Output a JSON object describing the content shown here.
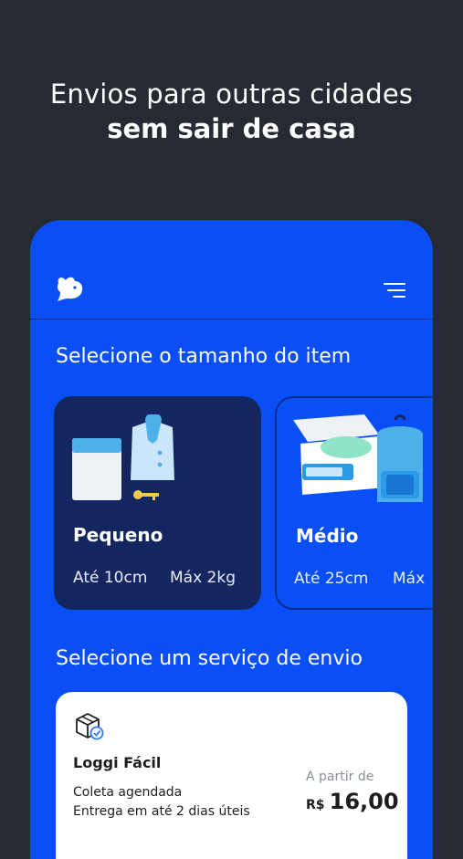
{
  "headline": {
    "line1": "Envios para outras cidades",
    "line2": "sem sair de casa"
  },
  "app": {
    "logo_icon": "rabbit-logo-icon",
    "menu_icon": "menu-icon",
    "size_section_title": "Selecione o tamanho do item",
    "sizes": [
      {
        "name": "Pequeno",
        "max_dimension": "Até 10cm",
        "max_weight": "Máx 2kg",
        "selected": true,
        "illustration": "envelope-shirt-key-illustration"
      },
      {
        "name": "Médio",
        "max_dimension": "Até 25cm",
        "max_weight": "Máx",
        "selected": false,
        "illustration": "box-backpack-illustration"
      }
    ],
    "service_section_title": "Selecione um serviço de envio",
    "service": {
      "icon": "package-check-icon",
      "name": "Loggi Fácil",
      "line1": "Coleta agendada",
      "line2": "Entrega em até 2 dias úteis",
      "price_prefix": "A partir de",
      "currency": "R$",
      "price": "16,00"
    }
  },
  "colors": {
    "background": "#262a33",
    "brand_blue": "#0a4ff5",
    "selected_card": "#13265f",
    "white": "#ffffff"
  }
}
